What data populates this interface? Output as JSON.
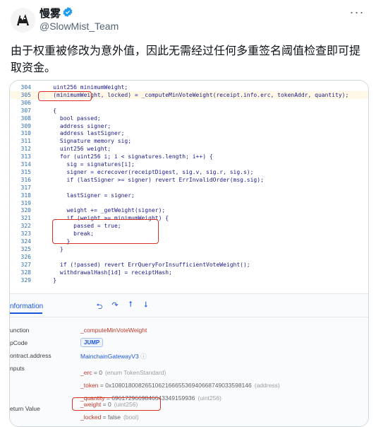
{
  "tweet": {
    "author_name": "慢雾",
    "handle": "@SlowMist_Team",
    "more_label": "···",
    "text": "由于权重被修改为意外值，因此无需经过任何多重签名阈值检查即可提取资金。"
  },
  "code": {
    "lines": [
      {
        "ln": "304",
        "src": "    uint256 minimumWeight;"
      },
      {
        "ln": "305",
        "src": "    (minimumWeight, locked) = _computeMinVoteWeight(receipt.info.erc, tokenAddr, quantity);"
      },
      {
        "ln": "306",
        "src": ""
      },
      {
        "ln": "307",
        "src": "    {"
      },
      {
        "ln": "308",
        "src": "      bool passed;"
      },
      {
        "ln": "309",
        "src": "      address signer;"
      },
      {
        "ln": "310",
        "src": "      address lastSigner;"
      },
      {
        "ln": "311",
        "src": "      Signature memory sig;"
      },
      {
        "ln": "312",
        "src": "      uint256 weight;"
      },
      {
        "ln": "313",
        "src": "      for (uint256 i; i < signatures.length; i++) {"
      },
      {
        "ln": "314",
        "src": "        sig = signatures[i];"
      },
      {
        "ln": "315",
        "src": "        signer = ecrecover(receiptDigest, sig.v, sig.r, sig.s);"
      },
      {
        "ln": "316",
        "src": "        if (lastSigner >= signer) revert ErrInvalidOrder(msg.sig);"
      },
      {
        "ln": "317",
        "src": ""
      },
      {
        "ln": "318",
        "src": "        lastSigner = signer;"
      },
      {
        "ln": "319",
        "src": ""
      },
      {
        "ln": "320",
        "src": "        weight += _getWeight(signer);"
      },
      {
        "ln": "321",
        "src": "        if (weight >= minimumWeight) {"
      },
      {
        "ln": "322",
        "src": "          passed = true;"
      },
      {
        "ln": "323",
        "src": "          break;"
      },
      {
        "ln": "324",
        "src": "        }"
      },
      {
        "ln": "325",
        "src": "      }"
      },
      {
        "ln": "326",
        "src": ""
      },
      {
        "ln": "327",
        "src": "      if (!passed) revert ErrQueryForInsufficientVoteWeight();"
      },
      {
        "ln": "328",
        "src": "      withdrawalHash[id] = receiptHash;"
      },
      {
        "ln": "329",
        "src": "    }"
      }
    ]
  },
  "info": {
    "tab_label": "nformation",
    "labels": {
      "function": "unction",
      "opcode": "pCode",
      "contract": "ontract.address",
      "inputs": "nputs",
      "return": "eturn Value"
    },
    "function_value": "_computeMinVoteWeight",
    "opcode_value": "JUMP",
    "contract_value": "MainchainGatewayV3",
    "contract_icon": "ⓘ",
    "inputs": [
      {
        "name": "_erc",
        "eq": " = ",
        "value": "0",
        "type": "(enum TokenStandard)"
      },
      {
        "name": "_token",
        "eq": " = ",
        "value": "0x108018008265106216665536940668749033598146",
        "type": "(address)"
      },
      {
        "name": "_quantity",
        "eq": " = ",
        "value": "6961729669846643349159936",
        "type": "(uint256)"
      }
    ],
    "returns": [
      {
        "name": "_weight",
        "eq": " = ",
        "value": "0",
        "type": "(uint256)"
      },
      {
        "name": "_locked",
        "eq": " = ",
        "value": "false",
        "type": "(bool)"
      }
    ],
    "toolbar_icons": [
      "step-back-icon",
      "step-over-icon",
      "step-up-icon",
      "step-down-icon"
    ]
  },
  "colors": {
    "highlight_line": "#fff8e6",
    "annotation_red": "#d93025",
    "verified_blue": "#1d9bf0",
    "link_blue": "#1a56db"
  }
}
